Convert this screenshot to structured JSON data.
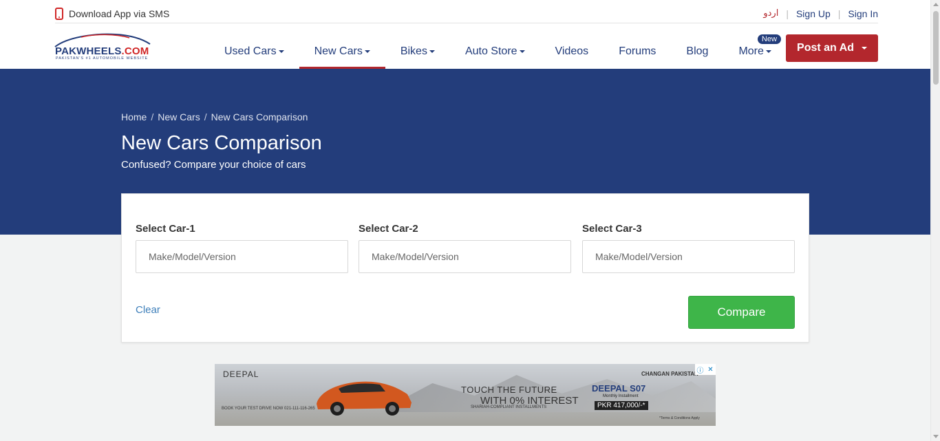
{
  "util_bar": {
    "download_text": "Download App via SMS",
    "urdu_link": "اردو",
    "sign_up": "Sign Up",
    "sign_in": "Sign In"
  },
  "logo": {
    "name_main": "PAKWHEELS",
    "name_suffix": ".COM",
    "tagline": "PAKISTAN'S #1 AUTOMOBILE WEBSITE"
  },
  "nav": {
    "items": [
      {
        "label": "Used Cars",
        "dropdown": true
      },
      {
        "label": "New Cars",
        "dropdown": true,
        "active": true
      },
      {
        "label": "Bikes",
        "dropdown": true
      },
      {
        "label": "Auto Store",
        "dropdown": true
      },
      {
        "label": "Videos",
        "dropdown": false
      },
      {
        "label": "Forums",
        "dropdown": false
      },
      {
        "label": "Blog",
        "dropdown": false
      },
      {
        "label": "More",
        "dropdown": true,
        "badge": "New"
      }
    ],
    "post_ad": "Post an Ad"
  },
  "hero": {
    "breadcrumb": [
      "Home",
      "New Cars",
      "New Cars Comparison"
    ],
    "title": "New Cars Comparison",
    "subtitle": "Confused? Compare your choice of cars"
  },
  "compare": {
    "fields": [
      {
        "label": "Select Car-1",
        "placeholder": "Make/Model/Version",
        "value": ""
      },
      {
        "label": "Select Car-2",
        "placeholder": "Make/Model/Version",
        "value": ""
      },
      {
        "label": "Select Car-3",
        "placeholder": "Make/Model/Version",
        "value": ""
      }
    ],
    "clear": "Clear",
    "compare_button": "Compare"
  },
  "ad": {
    "brand": "DEEPAL",
    "headline": "TOUCH THE FUTURE",
    "interest": "WITH 0% INTEREST",
    "shariah": "SHARIAH-COMPLIANT INSTALLMENTS",
    "model": "DEEPAL S07",
    "monthly": "Monthly Installment",
    "price": "PKR 417,000/-*",
    "book": "BOOK YOUR TEST DRIVE NOW 021-111-116-265",
    "partner": "CHANGAN PAKISTAN",
    "terms": "*Terms & Conditions Apply"
  },
  "colors": {
    "brand_navy": "#233d7b",
    "brand_red": "#b3272d",
    "compare_green": "#3eb549",
    "link_blue": "#3e7fba"
  }
}
